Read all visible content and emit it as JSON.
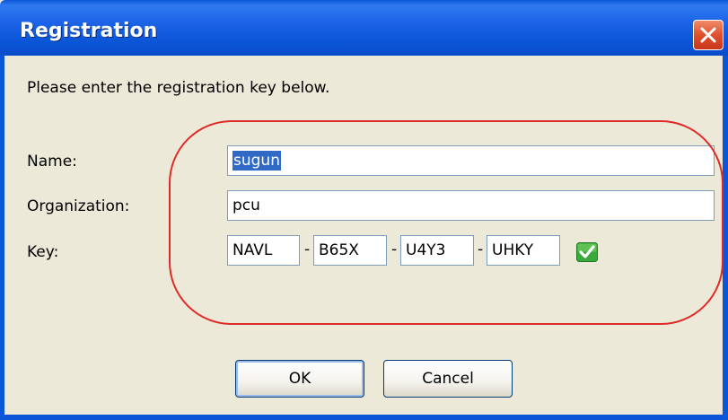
{
  "window": {
    "title": "Registration",
    "close_icon": "close-icon"
  },
  "instruction": "Please enter the registration key below.",
  "form": {
    "name_label": "Name:",
    "name_value": "sugun",
    "organization_label": "Organization:",
    "organization_value": "pcu",
    "key_label": "Key:",
    "key_parts": [
      "NAVL",
      "B65X",
      "U4Y3",
      "UHKY"
    ],
    "key_separator": "-",
    "key_valid_icon": "checkmark-icon",
    "key_valid_color": "#3BA83B"
  },
  "buttons": {
    "ok_label": "OK",
    "cancel_label": "Cancel"
  },
  "colors": {
    "titlebar": "#0B55D8",
    "dialog_background": "#ECE9D8",
    "annotation_ellipse": "#E02A28",
    "selection": "#316AC5"
  }
}
